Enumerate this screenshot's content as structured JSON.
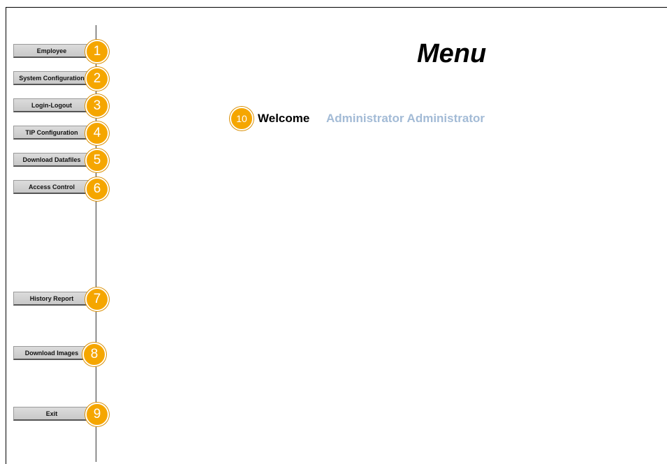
{
  "page": {
    "title": "Menu"
  },
  "welcome": {
    "label": "Welcome",
    "user": "Administrator Administrator",
    "badge": "10"
  },
  "menu": [
    {
      "label": "Employee",
      "badge": "1"
    },
    {
      "label": "System Configuration",
      "badge": "2"
    },
    {
      "label": "Login-Logout",
      "badge": "3"
    },
    {
      "label": "TIP Configuration",
      "badge": "4"
    },
    {
      "label": "Download Datafiles",
      "badge": "5"
    },
    {
      "label": "Access Control",
      "badge": "6"
    },
    {
      "label": "History Report",
      "badge": "7"
    },
    {
      "label": "Download Images",
      "badge": "8"
    },
    {
      "label": "Exit",
      "badge": "9"
    }
  ],
  "colors": {
    "badge": "#f5a600",
    "username": "#a3bbd6",
    "button": "#d3d3d3"
  }
}
